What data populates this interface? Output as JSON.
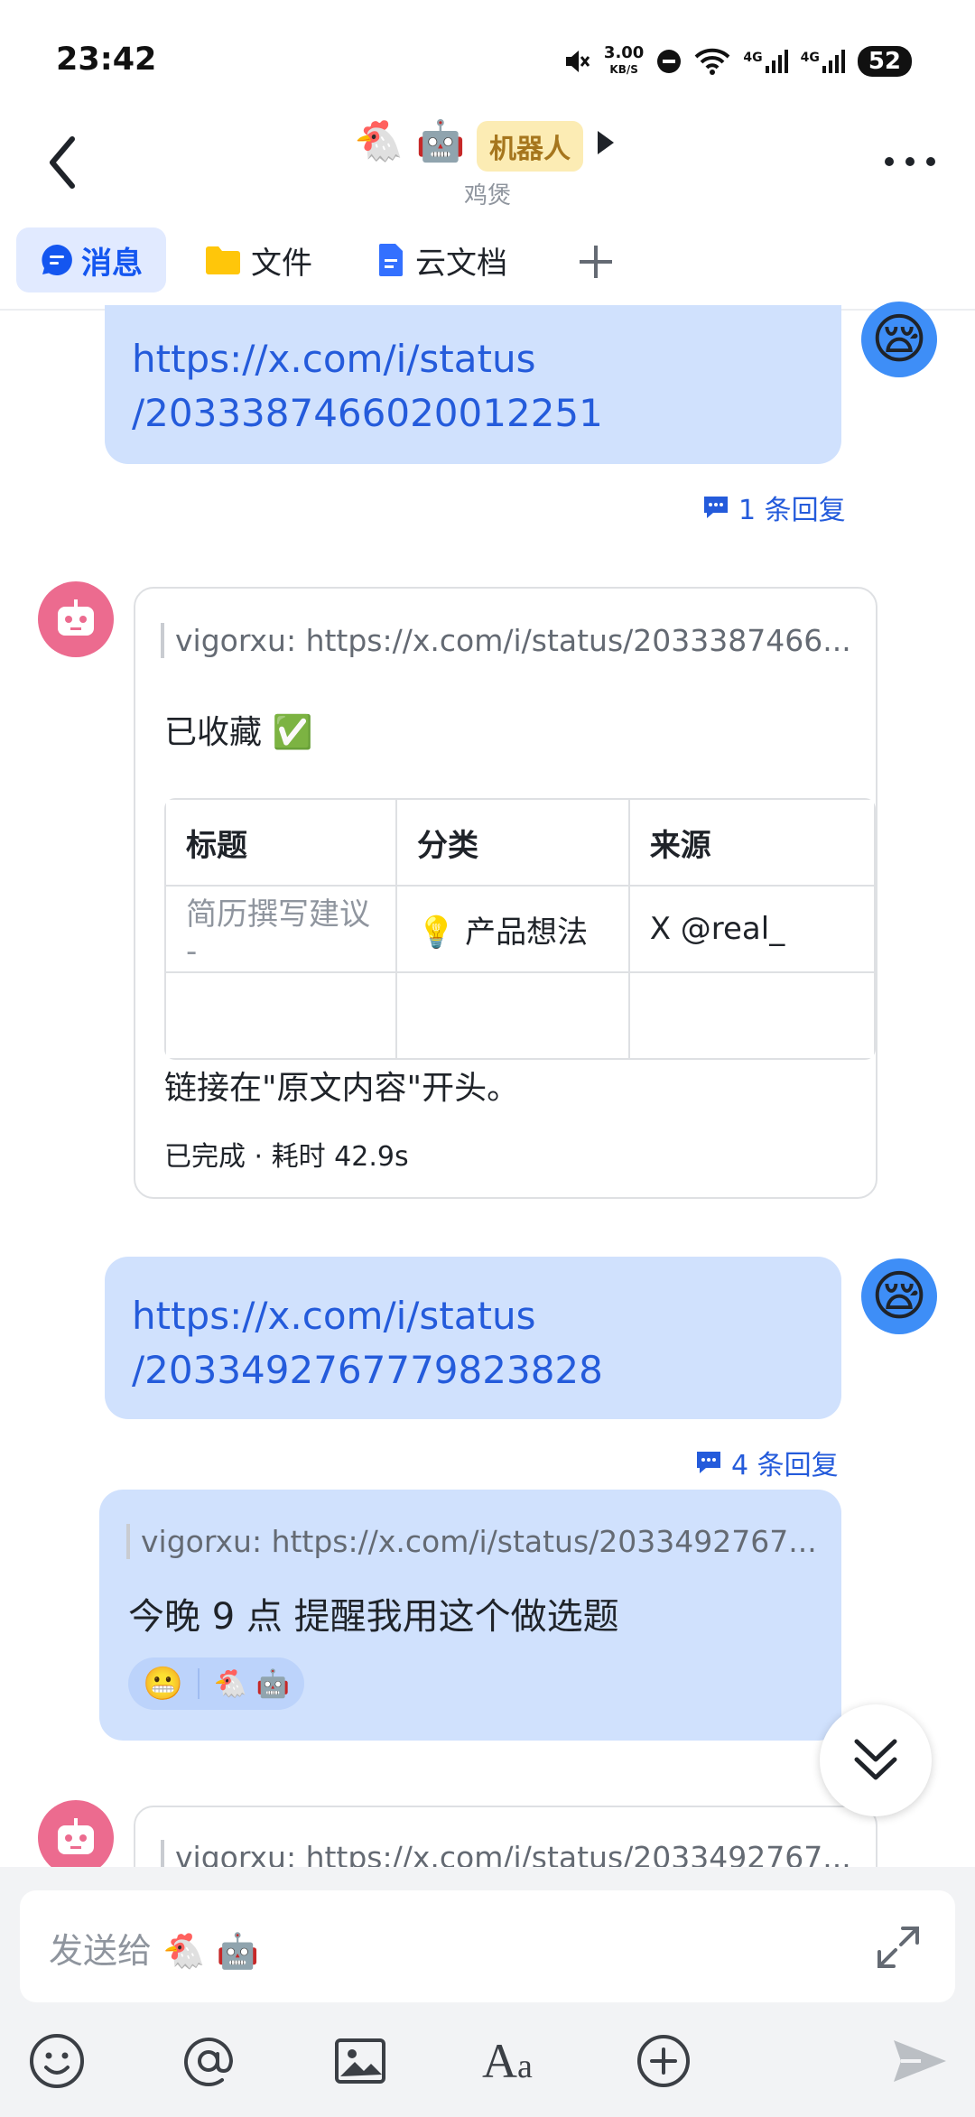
{
  "status": {
    "time": "23:42",
    "net_speed": "3.00",
    "net_unit": "KB/S",
    "sig1": "4G",
    "sig2": "4G",
    "battery": "52"
  },
  "header": {
    "title_emoji": "🐔 🤖",
    "bot_badge": "机器人",
    "subtitle": "鸡煲"
  },
  "tabs": [
    {
      "label": "消息",
      "icon": "message-icon"
    },
    {
      "label": "文件",
      "icon": "folder-icon"
    },
    {
      "label": "云文档",
      "icon": "doc-icon"
    }
  ],
  "messages": {
    "m1": {
      "link_line1": "https://x.com/i/status",
      "link_line2": "/2033387466020012251",
      "reply_count": "1 条回复"
    },
    "m2": {
      "quote": "vigorxu: https://x.com/i/status/2033387466...",
      "text": "已收藏 ✅",
      "table": {
        "headers": [
          "标题",
          "分类",
          "来源"
        ],
        "rows": [
          [
            "简历撰写建议 -",
            "💡 产品想法",
            "X @real_"
          ],
          [
            "",
            "",
            ""
          ]
        ]
      },
      "footer_text": "链接在\"原文内容\"开头。",
      "status": "已完成 · 耗时 42.9s"
    },
    "m3": {
      "link_line1": "https://x.com/i/status",
      "link_line2": "/2033492767779823828",
      "reply_count": "4 条回复"
    },
    "m4": {
      "quote": "vigorxu: https://x.com/i/status/2033492767...",
      "text": "今晚 9 点 提醒我用这个做选题",
      "reaction_who": "🐔 🤖"
    },
    "m5": {
      "quote": "vigorxu: https://x.com/i/status/2033492767..."
    }
  },
  "input": {
    "placeholder": "发送给 🐔 🤖"
  },
  "colors": {
    "accent": "#245bdb",
    "bubble": "#d0e1fd",
    "bot_avatar": "#ec6b8f"
  }
}
